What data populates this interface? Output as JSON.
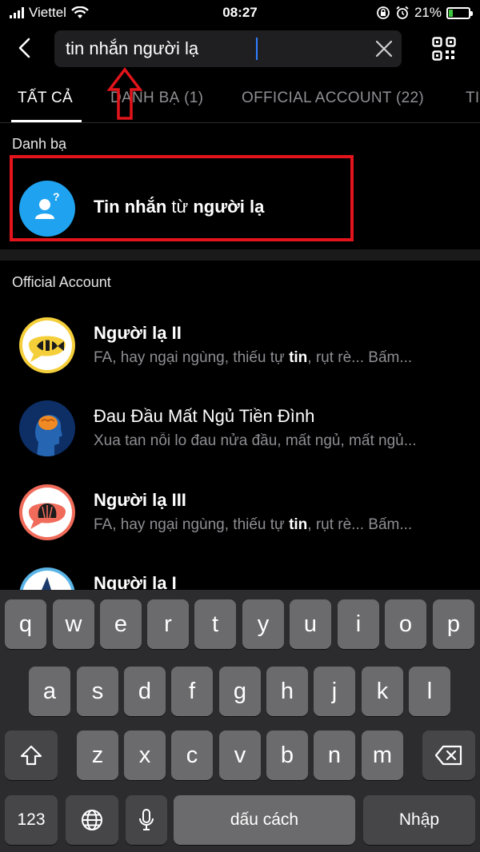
{
  "status_bar": {
    "carrier": "Viettel",
    "time": "08:27",
    "battery_percent": "21%",
    "battery_level": 0.21
  },
  "search": {
    "value": "tin nhắn người lạ",
    "placeholder": ""
  },
  "tabs": [
    {
      "label": "TẤT CẢ",
      "active": true
    },
    {
      "label": "DANH BẠ (1)",
      "active": false
    },
    {
      "label": "OFFICIAL ACCOUNT (22)",
      "active": false
    },
    {
      "label": "TI",
      "active": false
    }
  ],
  "contacts_section": {
    "title": "Danh bạ",
    "item": {
      "title_bold_1": "Tin nhắn",
      "title_normal": " từ ",
      "title_bold_2": "người lạ"
    }
  },
  "oa_section": {
    "title": "Official Account",
    "items": [
      {
        "name": "Người lạ II",
        "desc_pre": "FA, hay ngại ngùng, thiếu tự ",
        "desc_bold": "tin",
        "desc_post": ", rụt rè... Bấm...",
        "name_bold": true
      },
      {
        "name": "Đau Đầu Mất Ngủ Tiền Đình",
        "desc_pre": "Xua tan nỗi lo đau nửa đầu, mất ngủ, mất ngủ...",
        "desc_bold": "",
        "desc_post": "",
        "name_bold": false
      },
      {
        "name": "Người lạ III",
        "desc_pre": "FA, hay ngại ngùng, thiếu tự ",
        "desc_bold": "tin",
        "desc_post": ", rụt rè... Bấm...",
        "name_bold": true
      },
      {
        "name": "Người lạ I",
        "desc_pre": "",
        "desc_bold": "",
        "desc_post": "",
        "name_bold": true
      }
    ]
  },
  "keyboard": {
    "row1": [
      "q",
      "w",
      "e",
      "r",
      "t",
      "y",
      "u",
      "i",
      "o",
      "p"
    ],
    "row2": [
      "a",
      "s",
      "d",
      "f",
      "g",
      "h",
      "j",
      "k",
      "l"
    ],
    "row3": [
      "z",
      "x",
      "c",
      "v",
      "b",
      "n",
      "m"
    ],
    "numbers_label": "123",
    "space_label": "dấu cách",
    "return_label": "Nhập"
  },
  "colors": {
    "annotation_red": "#e3141b",
    "accent_blue": "#2f80ff",
    "contact_avatar": "#1fa3f0"
  }
}
